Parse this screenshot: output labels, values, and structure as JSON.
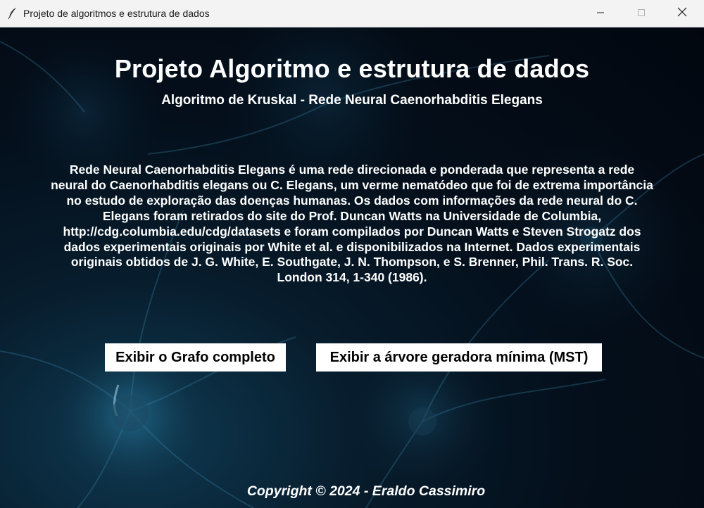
{
  "window": {
    "title": "Projeto de algoritmos e estrutura de dados",
    "app_icon": "feather-icon",
    "controls": [
      "minimize-icon",
      "maximize-icon",
      "close-icon"
    ]
  },
  "main": {
    "title": "Projeto Algoritmo e estrutura de dados",
    "subtitle": "Algoritmo de Kruskal - Rede Neural Caenorhabditis Elegans",
    "description": "Rede Neural Caenorhabditis Elegans é uma rede direcionada e ponderada que representa a rede neural do Caenorhabditis elegans ou C. Elegans, um verme nematódeo que foi de extrema importância no estudo de exploração das doenças humanas. Os dados com informações da rede neural do C. Elegans foram retirados do site do Prof. Duncan Watts na Universidade de Columbia, http://cdg.columbia.edu/cdg/datasets e foram compilados por Duncan Watts e Steven Strogatz dos dados experimentais originais por White et al. e disponibilizados na Internet. Dados experimentais originais obtidos de J. G. White, E. Southgate, J. N. Thompson, e S. Brenner, Phil. Trans. R. Soc. London 314, 1-340 (1986).",
    "buttons": {
      "full_graph": "Exibir o Grafo completo",
      "mst": "Exibir a árvore geradora mínima (MST)"
    },
    "footer": "Copyright © 2024 - Eraldo Cassimiro"
  },
  "colors": {
    "background_dark": "#02070f",
    "background_glow": "#0f3a52",
    "text": "#ffffff",
    "button_bg": "#ffffff",
    "titlebar_bg": "#f3f3f3"
  }
}
